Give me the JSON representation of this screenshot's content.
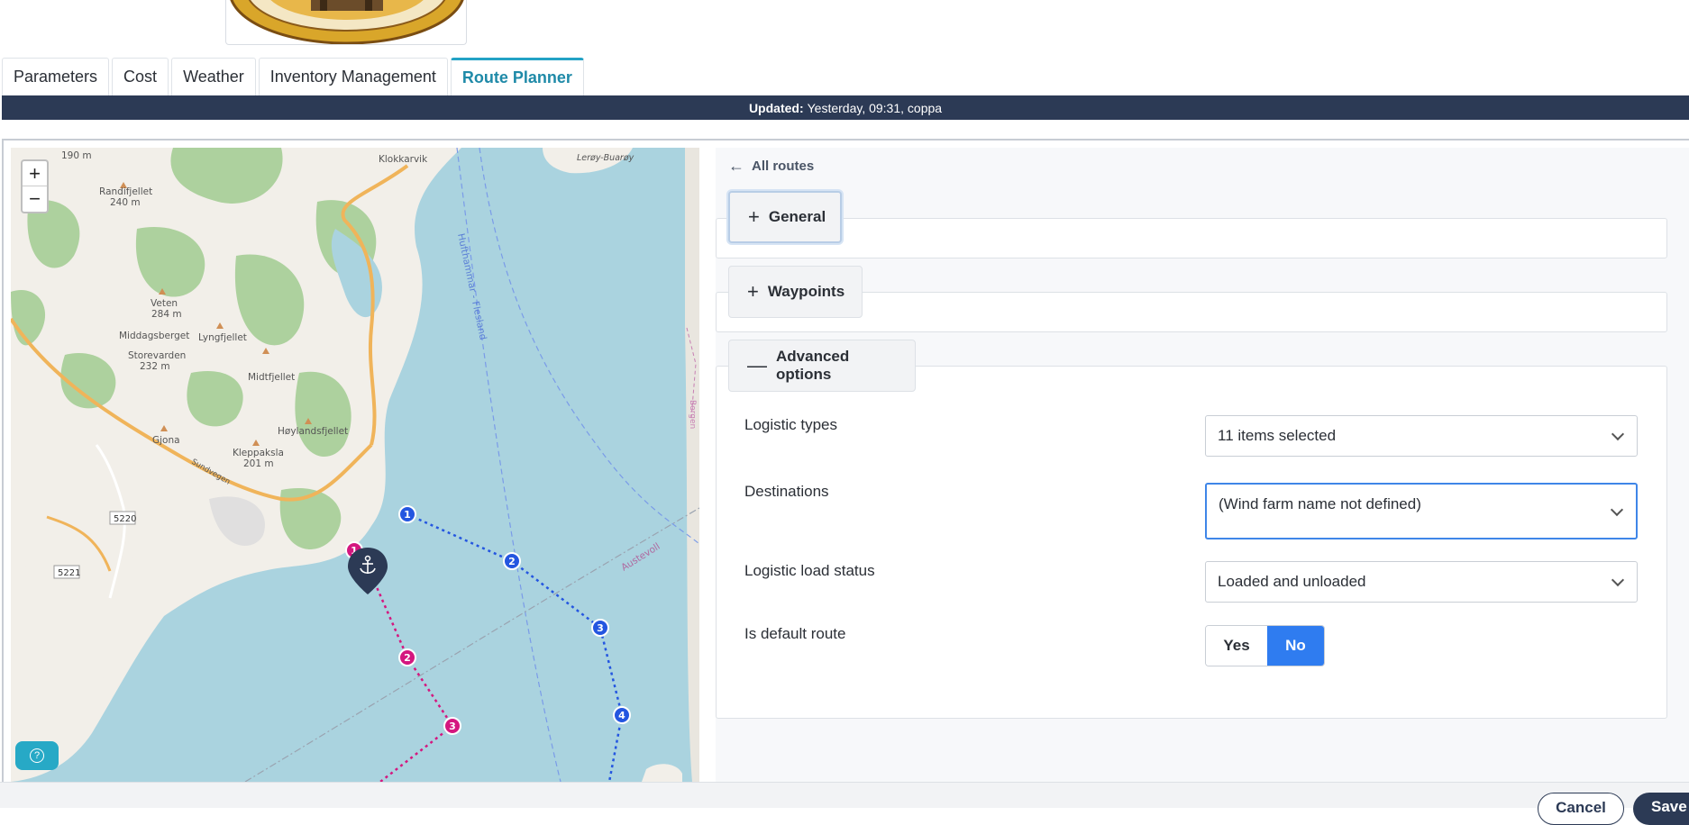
{
  "tabs": [
    {
      "label": "Parameters",
      "active": false
    },
    {
      "label": "Cost",
      "active": false
    },
    {
      "label": "Weather",
      "active": false
    },
    {
      "label": "Inventory Management",
      "active": false
    },
    {
      "label": "Route Planner",
      "active": true
    }
  ],
  "status": {
    "updated_label": "Updated:",
    "updated_value": "Yesterday, 09:31, coppa"
  },
  "map": {
    "zoom_in": "+",
    "zoom_out": "−",
    "places": {
      "klokkarvik": "Klokkarvik",
      "leroy": "Lerøy-Buarøy",
      "m190": "190 m",
      "randifjellet": "Randifjellet",
      "randifjellet_h": "240 m",
      "veten": "Veten",
      "veten_h": "284 m",
      "middagsberget": "Middagsberget",
      "lyngfjellet": "Lyngfjellet",
      "storevarden": "Storevarden",
      "storevarden_h": "232 m",
      "midtfjellet": "Midtfjellet",
      "hoylandsfjellet": "Høylandsfjellet",
      "gjona": "Gjona",
      "kleppaksla": "Kleppaksla",
      "kleppaksla_h": "201 m",
      "hufthammar": "Hufthammar - Flesland",
      "bergen": "Bergen",
      "austevoll": "Austevoll",
      "sundvegen": "Sundvegen",
      "r5220": "5220",
      "r5221": "5221"
    },
    "blue_waypoints": [
      "1",
      "2",
      "3",
      "4"
    ],
    "pink_waypoints": [
      "1",
      "2",
      "3"
    ],
    "route_colors": {
      "blue": "#2456e0",
      "pink": "#d4177f"
    },
    "help_icon": "?"
  },
  "panel": {
    "back_link": "All routes",
    "sections": {
      "general": {
        "symbol": "+",
        "label": "General"
      },
      "waypoints": {
        "symbol": "+",
        "label": "Waypoints"
      },
      "advanced": {
        "symbol": "—",
        "label": "Advanced options"
      }
    },
    "fields": {
      "logistic_types": {
        "label": "Logistic types",
        "value": "11 items selected"
      },
      "destinations": {
        "label": "Destinations",
        "value": "(Wind farm name not defined)"
      },
      "load_status": {
        "label": "Logistic load status",
        "value": "Loaded and unloaded"
      },
      "default_route": {
        "label": "Is default route",
        "yes": "Yes",
        "no": "No",
        "selected": "No"
      }
    }
  },
  "footer": {
    "cancel": "Cancel",
    "save": "Save"
  },
  "colors": {
    "accent": "#2f7cf0",
    "navy": "#2c3a55",
    "tab_active": "#1f8aa8"
  }
}
